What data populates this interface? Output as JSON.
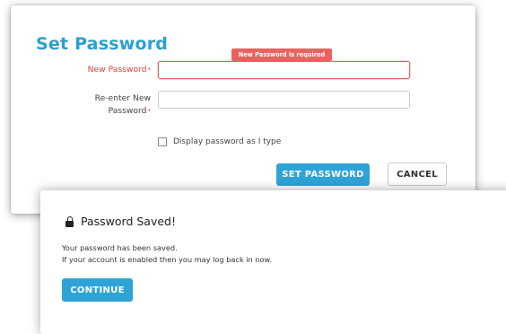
{
  "set_password": {
    "title": "Set Password",
    "error_tooltip": "New Password is required",
    "new_password_label": "New Password",
    "new_password_value": "",
    "reenter_label_line1": "Re-enter New",
    "reenter_label_line2": "Password",
    "reenter_value": "",
    "required_marker": "*",
    "display_password_label": "Display password as I type",
    "display_password_checked": false,
    "set_password_button": "SET PASSWORD",
    "cancel_button": "CANCEL"
  },
  "password_saved": {
    "title": "Password Saved!",
    "icon": "lock-icon",
    "message_line1": "Your password has been saved.",
    "message_line2": "If your account is enabled then you may log back in now.",
    "continue_button": "CONTINUE"
  },
  "colors": {
    "accent": "#2fa3d6",
    "error": "#e8635f",
    "title": "#2aa0cf"
  }
}
